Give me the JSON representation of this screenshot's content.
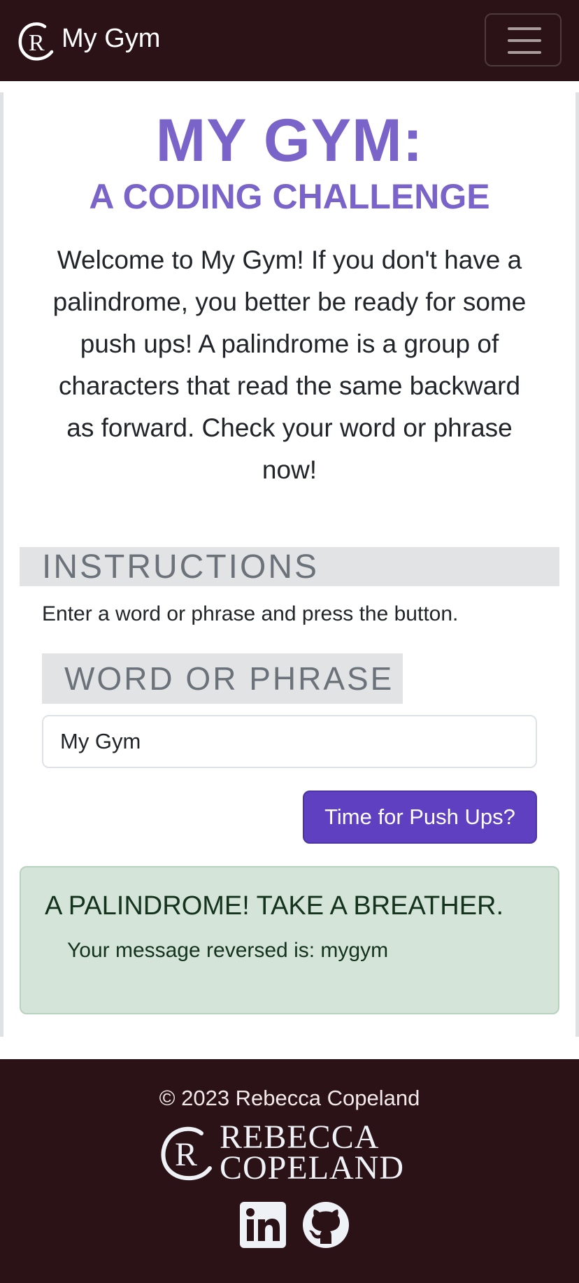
{
  "navbar": {
    "brand_text": "My Gym",
    "brand_logo_icon": "rc-monogram-icon",
    "menu_icon": "hamburger-menu-icon",
    "background_color": "#2b1216"
  },
  "hero": {
    "title": "MY GYM:",
    "subtitle": "A CODING CHALLENGE",
    "intro": "Welcome to My Gym! If you don't have a palindrome, you better be ready for some push ups! A palindrome is a group of characters that read the same backward as forward. Check your word or phrase now!",
    "accent_color": "#7b64c9"
  },
  "instructions": {
    "heading": "INSTRUCTIONS",
    "text": "Enter a word or phrase and press the button."
  },
  "form": {
    "label": "WORD OR PHRASE",
    "input_value": "My Gym",
    "button_label": "Time for Push Ups?",
    "button_color": "#5e40c0"
  },
  "result": {
    "title": "A PALINDROME! TAKE A BREATHER.",
    "message": "Your message reversed is: mygym",
    "background_color": "#d4e4d9"
  },
  "footer": {
    "copyright": "© 2023 Rebecca Copeland",
    "logo_line1": "REBECCA",
    "logo_line2": "COPELAND",
    "logo_icon": "rc-monogram-icon",
    "social": [
      {
        "name": "LinkedIn",
        "icon": "linkedin-icon"
      },
      {
        "name": "GitHub",
        "icon": "github-icon"
      }
    ]
  }
}
